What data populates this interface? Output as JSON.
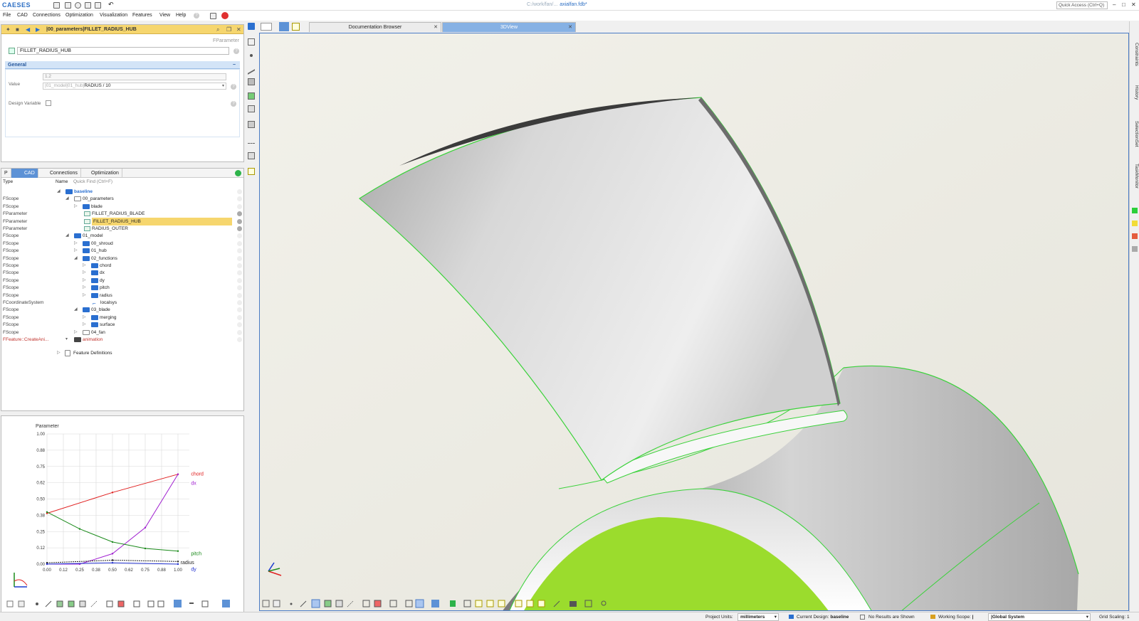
{
  "app": {
    "logo": "CAESES",
    "file_prefix": "C:/work/fan/...",
    "file_name": "axialfan.fdb*",
    "quick_access_placeholder": "Quick Access (Ctrl+Q)"
  },
  "menu": [
    "File",
    "CAD",
    "Connections",
    "Optimization",
    "Visualization",
    "Features",
    "View",
    "Help"
  ],
  "props": {
    "path": "|00_parameters|FILLET_RADIUS_HUB",
    "type": "FParameter",
    "name": "FILLET_RADIUS_HUB",
    "section": "General",
    "value_label": "Value",
    "value_result": "1.2",
    "value_expr_prefix": "|01_model|01_hub|",
    "value_expr": "RADIUS / 10",
    "design_var_label": "Design Variable"
  },
  "tree": {
    "tabs": [
      "P",
      "CAD",
      "Connections",
      "Optimization"
    ],
    "col_type": "Type",
    "col_name": "Name",
    "quick_find": "Quick Find (Ctrl+F)",
    "rows": [
      {
        "type": "",
        "name": "baseline"
      },
      {
        "type": "FScope",
        "name": "00_parameters"
      },
      {
        "type": "FScope",
        "name": "blade"
      },
      {
        "type": "FParameter",
        "name": "FILLET_RADIUS_BLADE"
      },
      {
        "type": "FParameter",
        "name": "FILLET_RADIUS_HUB"
      },
      {
        "type": "FParameter",
        "name": "RADIUS_OUTER"
      },
      {
        "type": "FScope",
        "name": "01_model"
      },
      {
        "type": "FScope",
        "name": "00_shroud"
      },
      {
        "type": "FScope",
        "name": "01_hub"
      },
      {
        "type": "FScope",
        "name": "02_functions"
      },
      {
        "type": "FScope",
        "name": "chord"
      },
      {
        "type": "FScope",
        "name": "dx"
      },
      {
        "type": "FScope",
        "name": "dy"
      },
      {
        "type": "FScope",
        "name": "pitch"
      },
      {
        "type": "FScope",
        "name": "radius"
      },
      {
        "type": "FCoordinateSystem",
        "name": "localsys"
      },
      {
        "type": "FScope",
        "name": "03_blade"
      },
      {
        "type": "FScope",
        "name": "merging"
      },
      {
        "type": "FScope",
        "name": "surface"
      },
      {
        "type": "FScope",
        "name": "04_fan"
      },
      {
        "type": "FFeature::CreateAni...",
        "name": "animation"
      }
    ],
    "feature_defs": "Feature Definitions"
  },
  "chart_data": {
    "type": "line",
    "title": "Parameter",
    "xlabel": "",
    "ylabel": "",
    "xlim": [
      0,
      1
    ],
    "ylim": [
      0,
      1
    ],
    "x_ticks": [
      "0.00",
      "0.12",
      "0.25",
      "0.38",
      "0.50",
      "0.62",
      "0.75",
      "0.88",
      "1.00"
    ],
    "y_ticks": [
      "0.00",
      "0.12",
      "0.25",
      "0.38",
      "0.50",
      "0.62",
      "0.75",
      "0.88",
      "1.00"
    ],
    "grid": true,
    "series": [
      {
        "name": "chord",
        "color": "#e02020",
        "x": [
          0,
          0.5,
          1
        ],
        "y": [
          0.39,
          0.55,
          0.69
        ]
      },
      {
        "name": "dx",
        "color": "#a020d0",
        "x": [
          0,
          0.25,
          0.5,
          0.75,
          1
        ],
        "y": [
          0,
          0.0,
          0.08,
          0.28,
          0.69
        ]
      },
      {
        "name": "pitch",
        "color": "#1a8a1a",
        "x": [
          0,
          0.25,
          0.5,
          0.75,
          1
        ],
        "y": [
          0.4,
          0.27,
          0.17,
          0.12,
          0.1
        ]
      },
      {
        "name": "radius",
        "color": "#222222",
        "x": [
          0,
          0.5,
          1
        ],
        "y": [
          0.01,
          0.03,
          0.02
        ]
      },
      {
        "name": "dy",
        "color": "#2030d0",
        "x": [
          0,
          0.5,
          1
        ],
        "y": [
          0.0,
          0.01,
          0.0
        ]
      }
    ]
  },
  "view_tabs": {
    "docs": "Documentation Browser",
    "view3d": "3DView"
  },
  "right_tabs": [
    "Constraints",
    "History",
    "SelectionSet",
    "TaskMonitor"
  ],
  "status": {
    "units_label": "Project Units:",
    "units": "millimeters",
    "design_label": "Current Design:",
    "design": "baseline",
    "results": "No Results are Shown",
    "scope_label": "Working Scope:",
    "scope": "|",
    "system": "|Global System",
    "grid_label": "Grid Scaling: 1"
  },
  "colors": {
    "accent": "#4a7bc5",
    "header_yellow": "#f6d66e",
    "hub_green": "#9bdc2d",
    "edge_green": "#3ad23a"
  }
}
